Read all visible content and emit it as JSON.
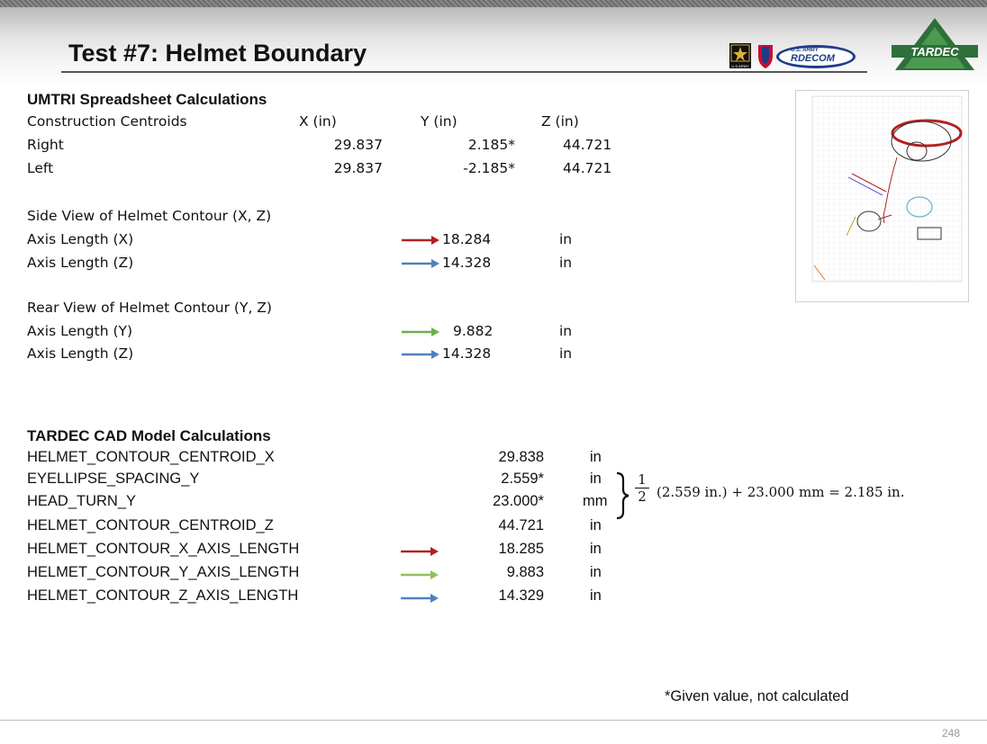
{
  "title": "Test #7: Helmet Boundary",
  "colors": {
    "red_arrow": "#b22222",
    "blue_arrow": "#4f81bd",
    "green_arrow": "#6ab04c",
    "green_arrow_light": "#8fc25a"
  },
  "logos": {
    "army_text": "U.S.ARMY",
    "rdecom_small": "U.S. ARMY",
    "rdecom": "RDECOM",
    "tardec": "TARDEC"
  },
  "umtri": {
    "heading": "UMTRI Spreadsheet Calculations",
    "header_row": {
      "label": "Construction Centroids",
      "x": "X (in)",
      "y": "Y (in)",
      "z": "Z (in)"
    },
    "rows": [
      {
        "label": "Right",
        "x": "29.837",
        "y": "2.185*",
        "z": "44.721"
      },
      {
        "label": "Left",
        "x": "29.837",
        "y": "-2.185*",
        "z": "44.721"
      }
    ],
    "side_view": {
      "heading": "Side View of Helmet Contour (X, Z)",
      "items": [
        {
          "label": "Axis Length (X)",
          "value": "18.284",
          "unit": "in",
          "arrow": "red-arrow"
        },
        {
          "label": "Axis Length (Z)",
          "value": "14.328",
          "unit": "in",
          "arrow": "blue-arrow"
        }
      ]
    },
    "rear_view": {
      "heading": "Rear View of Helmet Contour (Y, Z)",
      "items": [
        {
          "label": "Axis Length (Y)",
          "value": "9.882",
          "unit": "in",
          "arrow": "green-arrow"
        },
        {
          "label": "Axis Length (Z)",
          "value": "14.328",
          "unit": "in",
          "arrow": "blue-arrow"
        }
      ]
    }
  },
  "tardec_cad": {
    "heading": "TARDEC CAD Model Calculations",
    "rows": [
      {
        "label": "HELMET_CONTOUR_CENTROID_X",
        "value": "29.838",
        "unit": "in"
      },
      {
        "label": "EYELLIPSE_SPACING_Y",
        "value": "2.559*",
        "unit": "in"
      },
      {
        "label": "HEAD_TURN_Y",
        "value": "23.000*",
        "unit": "mm"
      },
      {
        "label": "HELMET_CONTOUR_CENTROID_Z",
        "value": "44.721",
        "unit": "in"
      },
      {
        "label": "HELMET_CONTOUR_X_AXIS_LENGTH",
        "value": "18.285",
        "unit": "in",
        "arrow": "red-arrow"
      },
      {
        "label": "HELMET_CONTOUR_Y_AXIS_LENGTH",
        "value": "9.883",
        "unit": "in",
        "arrow": "green-arrow"
      },
      {
        "label": "HELMET_CONTOUR_Z_AXIS_LENGTH",
        "value": "14.329",
        "unit": "in",
        "arrow": "blue-arrow"
      }
    ],
    "formula": {
      "numerator": "1",
      "denominator": "2",
      "expression": "(2.559 in.) + 23.000 mm = 2.185 in."
    }
  },
  "note": "*Given value, not calculated",
  "page_number": "248"
}
